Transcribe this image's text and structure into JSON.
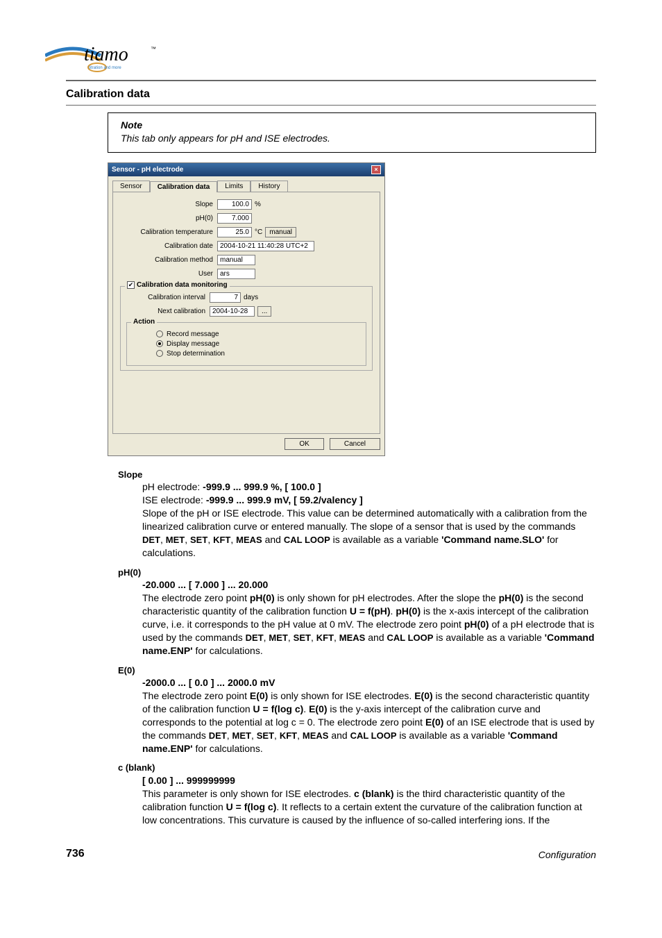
{
  "logo": {
    "text": "tiamo",
    "tagline": "titration and more"
  },
  "section_title": "Calibration data",
  "note": {
    "title": "Note",
    "text": "This tab only appears for pH and ISE electrodes."
  },
  "dialog": {
    "title": "Sensor - pH electrode",
    "tabs": {
      "sensor": "Sensor",
      "calib": "Calibration data",
      "limits": "Limits",
      "history": "History"
    },
    "fields": {
      "slope_label": "Slope",
      "slope_value": "100.0",
      "slope_unit": "%",
      "ph0_label": "pH(0)",
      "ph0_value": "7.000",
      "caltemp_label": "Calibration temperature",
      "caltemp_value": "25.0",
      "caltemp_unit": "°C",
      "caltemp_mode_btn": "manual",
      "caldate_label": "Calibration date",
      "caldate_value": "2004-10-21 11:40:28 UTC+2",
      "calmethod_label": "Calibration method",
      "calmethod_value": "manual",
      "user_label": "User",
      "user_value": "ars"
    },
    "monitoring": {
      "legend": "Calibration data monitoring",
      "interval_label": "Calibration interval",
      "interval_value": "7",
      "interval_unit": "days",
      "next_label": "Next calibration",
      "next_value": "2004-10-28",
      "more_btn": "...",
      "action_legend": "Action",
      "record": "Record message",
      "display": "Display message",
      "stop": "Stop determination"
    },
    "buttons": {
      "ok": "OK",
      "cancel": "Cancel"
    }
  },
  "params": {
    "slope": {
      "name": "Slope",
      "line_ph": "pH electrode:  ",
      "range_ph": "-999.9 ... 999.9 %, [ 100.0 ]",
      "line_ise": "ISE electrode:  ",
      "range_ise": "-999.9 ... 999.9 mV, [ 59.2/valency ]"
    },
    "ph0": {
      "name": "pH(0)",
      "range": "-20.000 ... [ 7.000 ] ... 20.000"
    },
    "e0": {
      "name": "E(0)",
      "range": "-2000.0 ... [ 0.0 ] ... 2000.0 mV"
    },
    "cblank": {
      "name": "c (blank)",
      "range": "[ 0.00 ] ... 999999999"
    }
  },
  "footer": {
    "page": "736",
    "label": "Configuration"
  }
}
